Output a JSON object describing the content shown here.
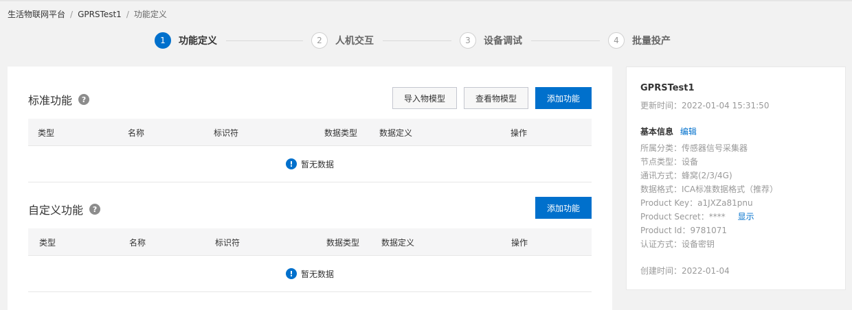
{
  "breadcrumb": {
    "root": "生活物联网平台",
    "product": "GPRSTest1",
    "current": "功能定义",
    "sep": "/"
  },
  "steps": [
    {
      "num": "1",
      "label": "功能定义",
      "active": true
    },
    {
      "num": "2",
      "label": "人机交互",
      "active": false
    },
    {
      "num": "3",
      "label": "设备调试",
      "active": false
    },
    {
      "num": "4",
      "label": "批量投产",
      "active": false
    }
  ],
  "standard": {
    "title": "标准功能",
    "help": "?",
    "import_btn": "导入物模型",
    "view_btn": "查看物模型",
    "add_btn": "添加功能",
    "columns": [
      "类型",
      "名称",
      "标识符",
      "数据类型",
      "数据定义",
      "操作"
    ],
    "empty_icon": "!",
    "empty": "暂无数据"
  },
  "custom": {
    "title": "自定义功能",
    "help": "?",
    "add_btn": "添加功能",
    "columns": [
      "类型",
      "名称",
      "标识符",
      "数据类型",
      "数据定义",
      "操作"
    ],
    "empty_icon": "!",
    "empty": "暂无数据"
  },
  "info": {
    "name": "GPRSTest1",
    "updated": "更新时间：2022-01-04 15:31:50",
    "basic_label": "基本信息",
    "edit_link": "编辑",
    "category": "所属分类：传感器信号采集器",
    "node_type": "节点类型：设备",
    "comm": "通讯方式：蜂窝(2/3/4G)",
    "data_format": "数据格式：ICA标准数据格式（推荐）",
    "product_key": "Product Key：a1JXZa81pnu",
    "product_secret": "Product Secret：****",
    "show_link": "显示",
    "product_id": "Product Id：9781071",
    "auth": "认证方式：设备密钥",
    "created": "创建时间：2022-01-04"
  }
}
